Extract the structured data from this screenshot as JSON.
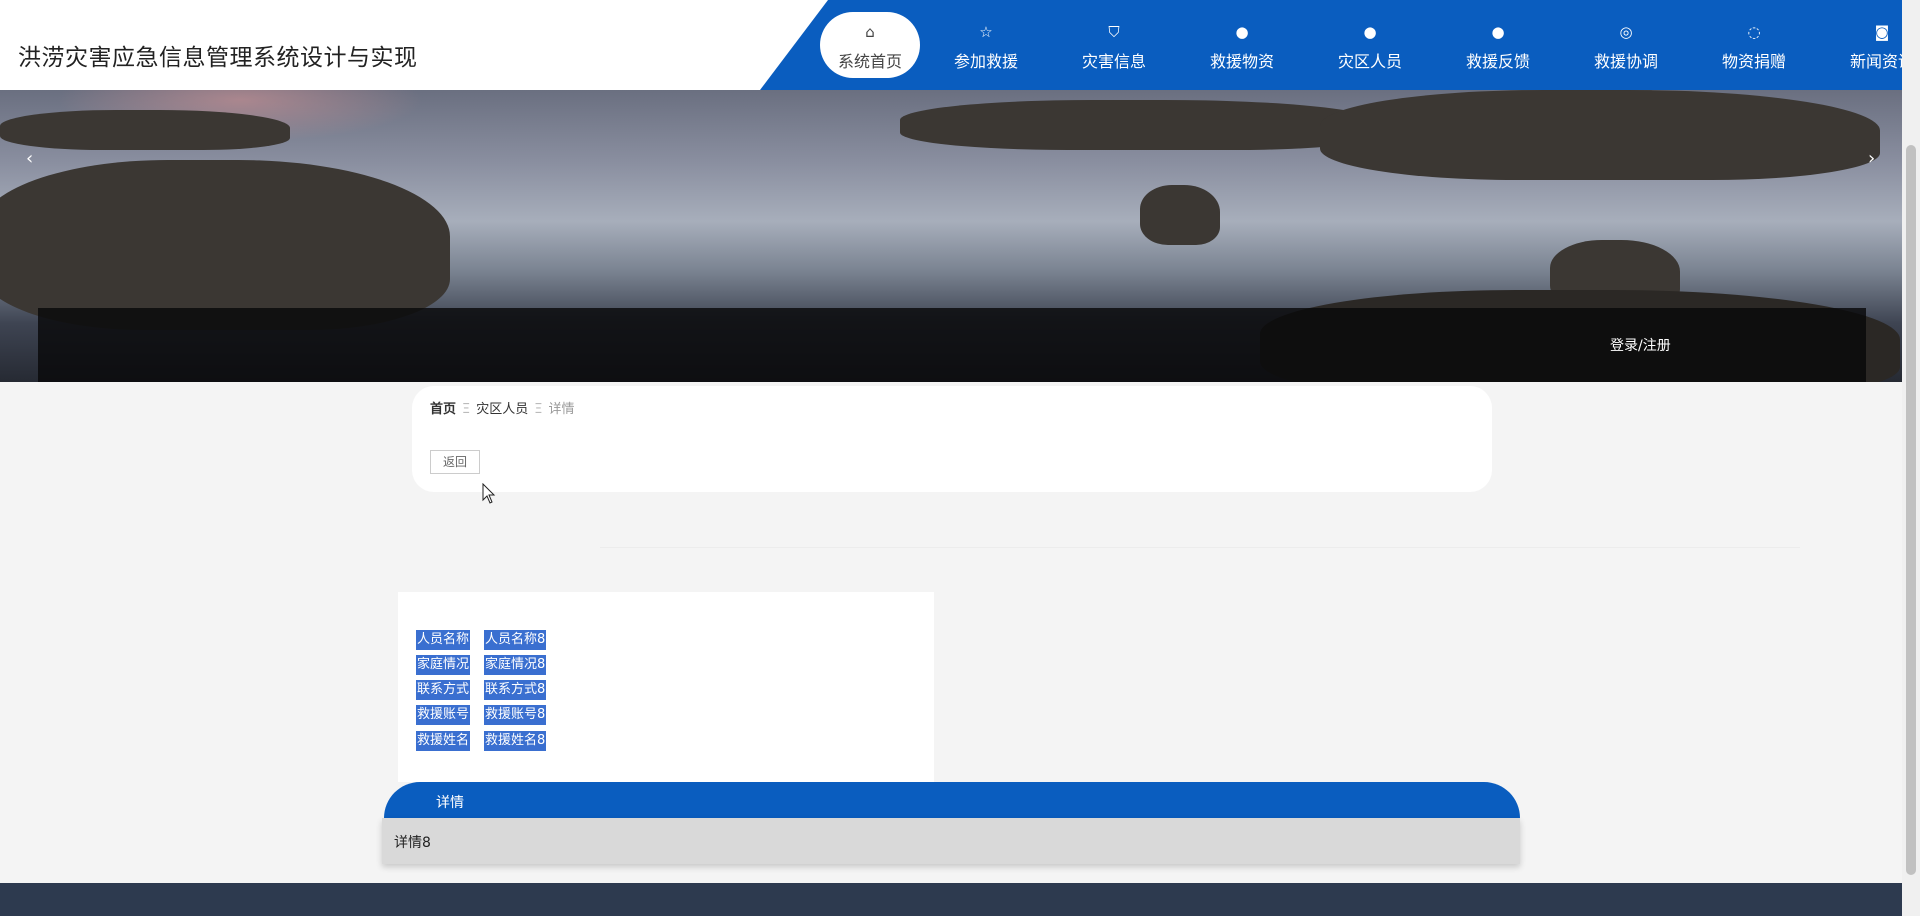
{
  "site_title": "洪涝灾害应急信息管理系统设计与实现",
  "nav": [
    {
      "label": "系统首页",
      "icon": "home-icon",
      "glyph": "⌂"
    },
    {
      "label": "参加救援",
      "icon": "star-icon",
      "glyph": "☆"
    },
    {
      "label": "灾害信息",
      "icon": "bag-icon",
      "glyph": "⛉"
    },
    {
      "label": "救援物资",
      "icon": "alert-icon",
      "glyph": "●"
    },
    {
      "label": "灾区人员",
      "icon": "question-icon",
      "glyph": "●"
    },
    {
      "label": "救援反馈",
      "icon": "info-icon",
      "glyph": "●"
    },
    {
      "label": "救援协调",
      "icon": "target-icon",
      "glyph": "◎"
    },
    {
      "label": "物资捐赠",
      "icon": "chart-icon",
      "glyph": "◌"
    },
    {
      "label": "新闻资讯",
      "icon": "camera-icon",
      "glyph": "◙"
    }
  ],
  "banner": {
    "prev": "‹",
    "next": "›",
    "login": "登录/注册"
  },
  "breadcrumb": {
    "home": "首页",
    "sep": "Ξ",
    "section": "灾区人员",
    "current": "详情"
  },
  "back_label": "返回",
  "info": [
    {
      "key": "人员名称",
      "value": "人员名称8"
    },
    {
      "key": "家庭情况",
      "value": "家庭情况8"
    },
    {
      "key": "联系方式",
      "value": "联系方式8"
    },
    {
      "key": "救援账号",
      "value": "救援账号8"
    },
    {
      "key": "救援姓名",
      "value": "救援姓名8"
    }
  ],
  "detail": {
    "tab_label": "详情",
    "content": "详情8"
  },
  "colors": {
    "primary": "#0a5dbf",
    "selection": "#3a6fd0",
    "footer": "#2d3a4f"
  }
}
